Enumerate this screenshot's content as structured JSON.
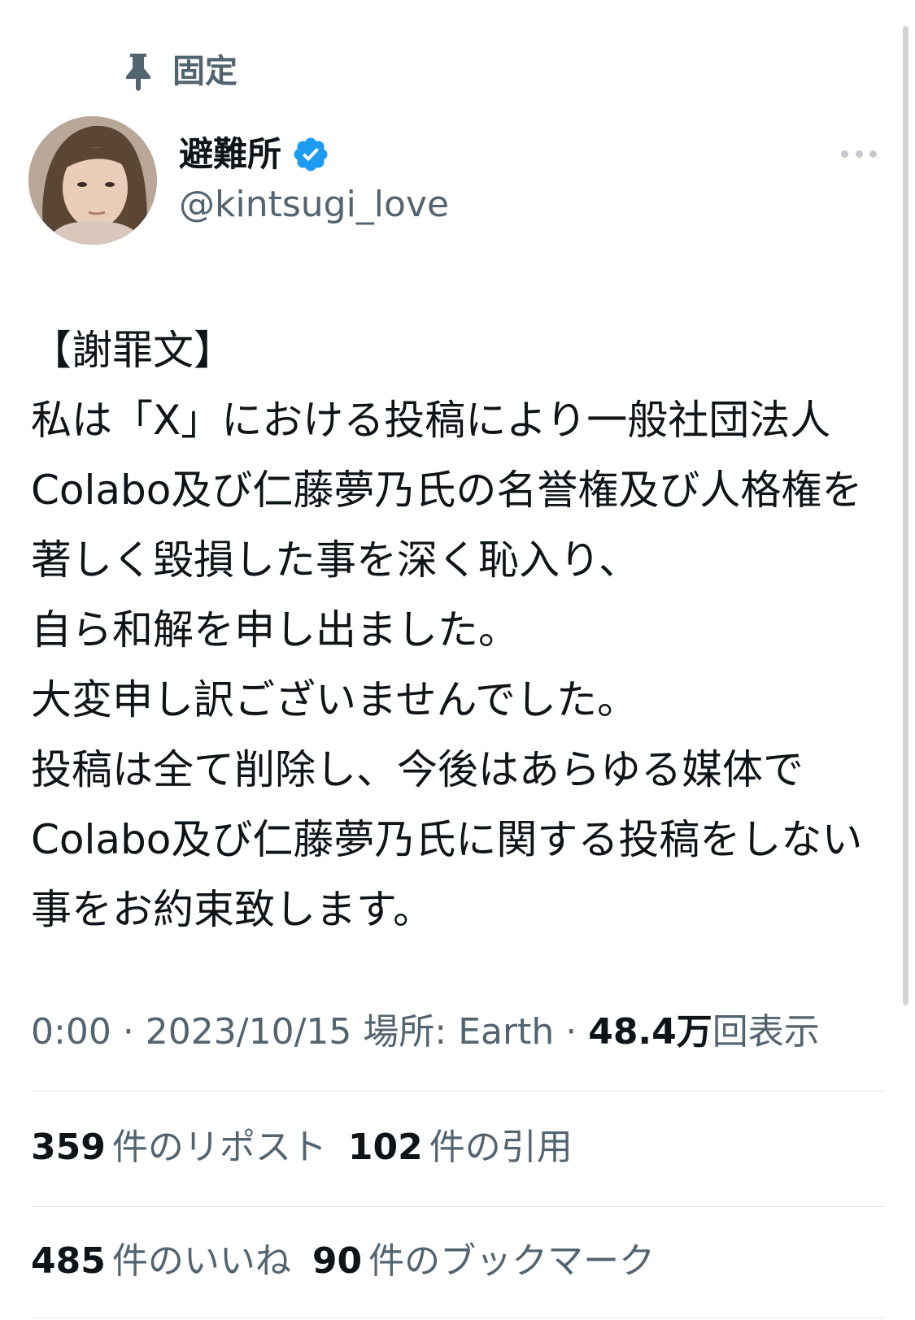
{
  "pinned": {
    "label": "固定",
    "icon": "pin-icon"
  },
  "author": {
    "display_name": "避難所",
    "handle": "@kintsugi_love",
    "verified_icon": "verified-badge-icon",
    "verified_color": "#1d9bf0"
  },
  "tweet": {
    "text": "【謝罪文】\n私は「X」における投稿により一般社団法人Colabo及び仁藤夢乃氏の名誉権及び人格権を著しく毀損した事を深く恥入り、\n自ら和解を申し出ました。\n大変申し訳ございませんでした。\n投稿は全て削除し、今後はあらゆる媒体でColabo及び仁藤夢乃氏に関する投稿をしない事をお約束致します。",
    "time": "0:00",
    "date": "2023/10/15",
    "location_label": "場所: Earth",
    "views_count": "48.4万",
    "views_label": "回表示"
  },
  "stats": {
    "reposts_count": "359",
    "reposts_label": "件のリポスト",
    "quotes_count": "102",
    "quotes_label": "件の引用",
    "likes_count": "485",
    "likes_label": "件のいいね",
    "bookmarks_count": "90",
    "bookmarks_label": "件のブックマーク"
  },
  "colors": {
    "text_primary": "#0f1419",
    "text_secondary": "#536471",
    "divider": "#e3e7ea"
  }
}
